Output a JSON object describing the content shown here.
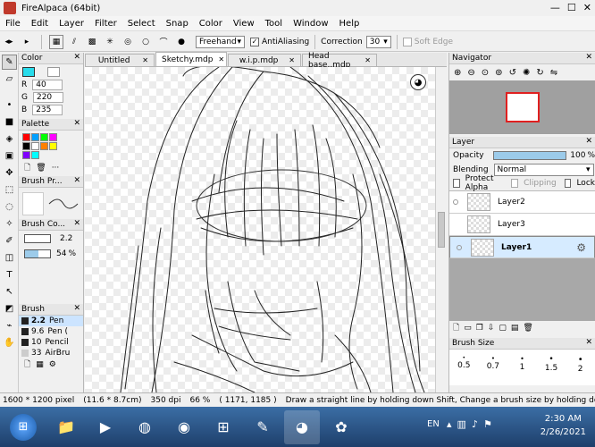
{
  "window": {
    "title": "FireAlpaca (64bit)"
  },
  "menu": [
    "File",
    "Edit",
    "Layer",
    "Filter",
    "Select",
    "Snap",
    "Color",
    "View",
    "Tool",
    "Window",
    "Help"
  ],
  "toolbar": {
    "brush_mode": "Freehand",
    "antialiasing_label": "AntiAliasing",
    "antialiasing_checked": "✓",
    "correction_label": "Correction",
    "correction_value": "30",
    "soft_edge_label": "Soft Edge"
  },
  "color_panel": {
    "title": "Color",
    "r_label": "R",
    "r": "40",
    "g_label": "G",
    "g": "220",
    "b_label": "B",
    "b": "235",
    "swatch": "#28dceb"
  },
  "palette_panel": {
    "title": "Palette",
    "colors": [
      "#ff0000",
      "#00a0ff",
      "#00ff00",
      "#ff00ff",
      "#000000",
      "#ffffff",
      "#ff8000",
      "#ffff00",
      "#8000ff",
      "#00ffff"
    ]
  },
  "brush_preview_panel": {
    "title": "Brush Pr..."
  },
  "brush_control_panel": {
    "title": "Brush Co...",
    "size": "2.2",
    "opacity": "54",
    "opacity_unit": "%"
  },
  "brush_panel": {
    "title": "Brush",
    "items": [
      {
        "size": "2.2",
        "name": "Pen"
      },
      {
        "size": "9.6",
        "name": "Pen ("
      },
      {
        "size": "10",
        "name": "Pencil"
      },
      {
        "size": "33",
        "name": "AirBru"
      }
    ]
  },
  "tabs": [
    {
      "label": "Untitled",
      "active": false
    },
    {
      "label": "Sketchy.mdp",
      "active": true
    },
    {
      "label": "w.i.p.mdp",
      "active": false
    },
    {
      "label": "Head base..mdp",
      "active": false
    }
  ],
  "navigator_panel": {
    "title": "Navigator"
  },
  "layer_panel": {
    "title": "Layer",
    "opacity_label": "Opacity",
    "opacity_value": "100",
    "opacity_unit": "%",
    "blending_label": "Blending",
    "blending_value": "Normal",
    "protect_alpha_label": "Protect Alpha",
    "clipping_label": "Clipping",
    "lock_label": "Lock",
    "layers": [
      {
        "name": "Layer2",
        "selected": false
      },
      {
        "name": "Layer3",
        "selected": false
      },
      {
        "name": "Layer1",
        "selected": true
      }
    ]
  },
  "brush_size_panel": {
    "title": "Brush Size",
    "sizes": [
      "0.5",
      "0.7",
      "1",
      "1.5",
      "2"
    ]
  },
  "status": {
    "dimensions": "1600 * 1200 pixel",
    "physical": "(11.6 * 8.7cm)",
    "dpi": "350 dpi",
    "zoom": "66 %",
    "coords": "( 1171, 1185 )",
    "hint": "Draw a straight line by holding down Shift, Change a brush size by holding down Ctrl, A"
  },
  "taskbar": {
    "lang": "EN",
    "time": "2:30 AM",
    "date": "2/26/2021"
  }
}
